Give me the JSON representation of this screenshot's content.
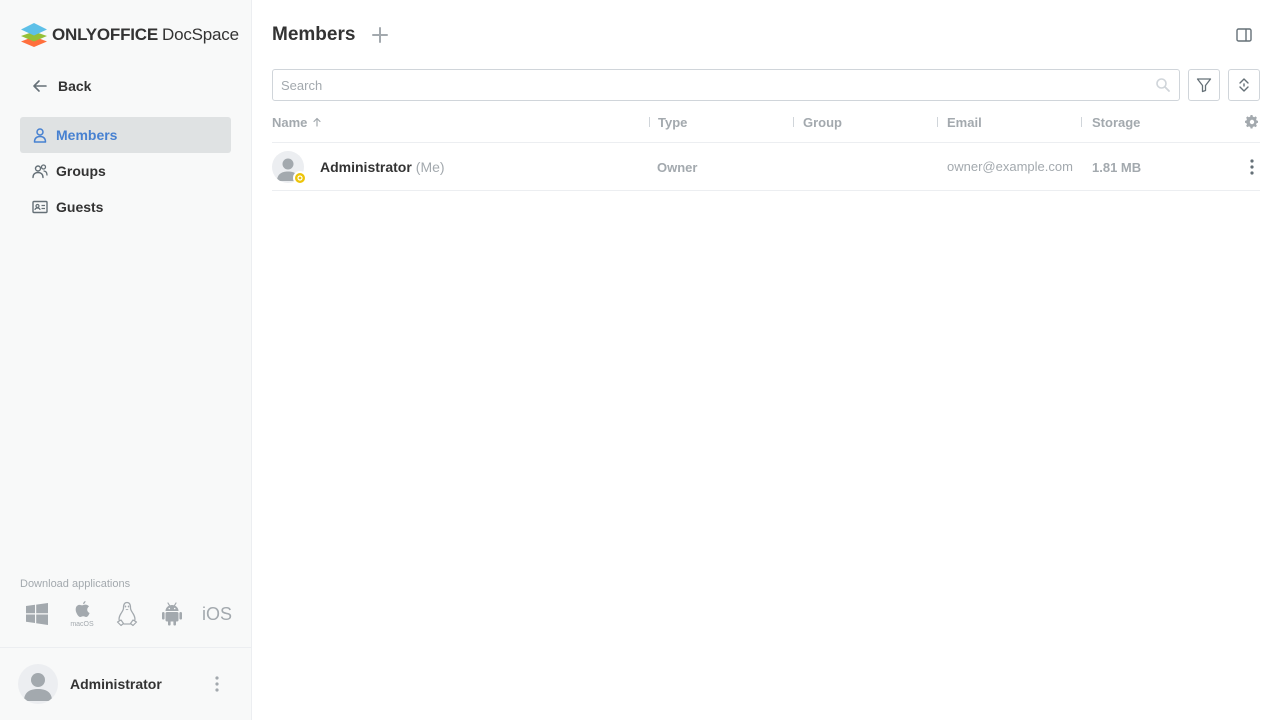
{
  "app": {
    "brand": "ONLYOFFICE",
    "product": "DocSpace"
  },
  "sidebar": {
    "back_label": "Back",
    "items": [
      {
        "label": "Members",
        "icon": "person-icon",
        "active": true
      },
      {
        "label": "Groups",
        "icon": "group-icon",
        "active": false
      },
      {
        "label": "Guests",
        "icon": "id-card-icon",
        "active": false
      }
    ],
    "download_title": "Download applications",
    "apps": [
      {
        "name": "windows-icon"
      },
      {
        "name": "apple-icon",
        "sub": "macOS"
      },
      {
        "name": "linux-icon"
      },
      {
        "name": "android-icon"
      },
      {
        "name": "ios-icon",
        "label": "iOS"
      }
    ],
    "profile_name": "Administrator"
  },
  "main": {
    "title": "Members",
    "search_placeholder": "Search",
    "columns": {
      "name": "Name",
      "type": "Type",
      "group": "Group",
      "email": "Email",
      "storage": "Storage"
    },
    "rows": [
      {
        "name": "Administrator",
        "me": "(Me)",
        "type": "Owner",
        "group": "",
        "email": "owner@example.com",
        "storage": "1.81 MB"
      }
    ]
  },
  "colors": {
    "accent": "#4781d1",
    "owner_badge": "#edc409",
    "muted": "#a3a9ae",
    "border": "#d0d5da"
  }
}
